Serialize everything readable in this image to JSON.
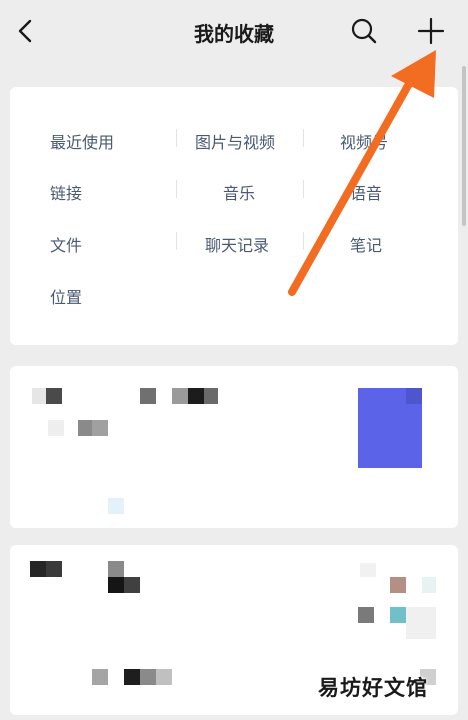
{
  "header": {
    "title": "我的收藏",
    "back_icon": "chevron-left-icon",
    "search_icon": "search-icon",
    "add_icon": "plus-icon"
  },
  "filters": {
    "recent": "最近使用",
    "images_videos": "图片与视频",
    "channels": "视频号",
    "links": "链接",
    "music": "音乐",
    "voice": "语音",
    "files": "文件",
    "chat_history": "聊天记录",
    "notes": "笔记",
    "location": "位置"
  },
  "annotation": {
    "arrow_color": "#f26d21"
  },
  "colors": {
    "accent": "#5b63e8",
    "filter_text": "#4b5a73"
  },
  "watermark": "易坊好文馆"
}
